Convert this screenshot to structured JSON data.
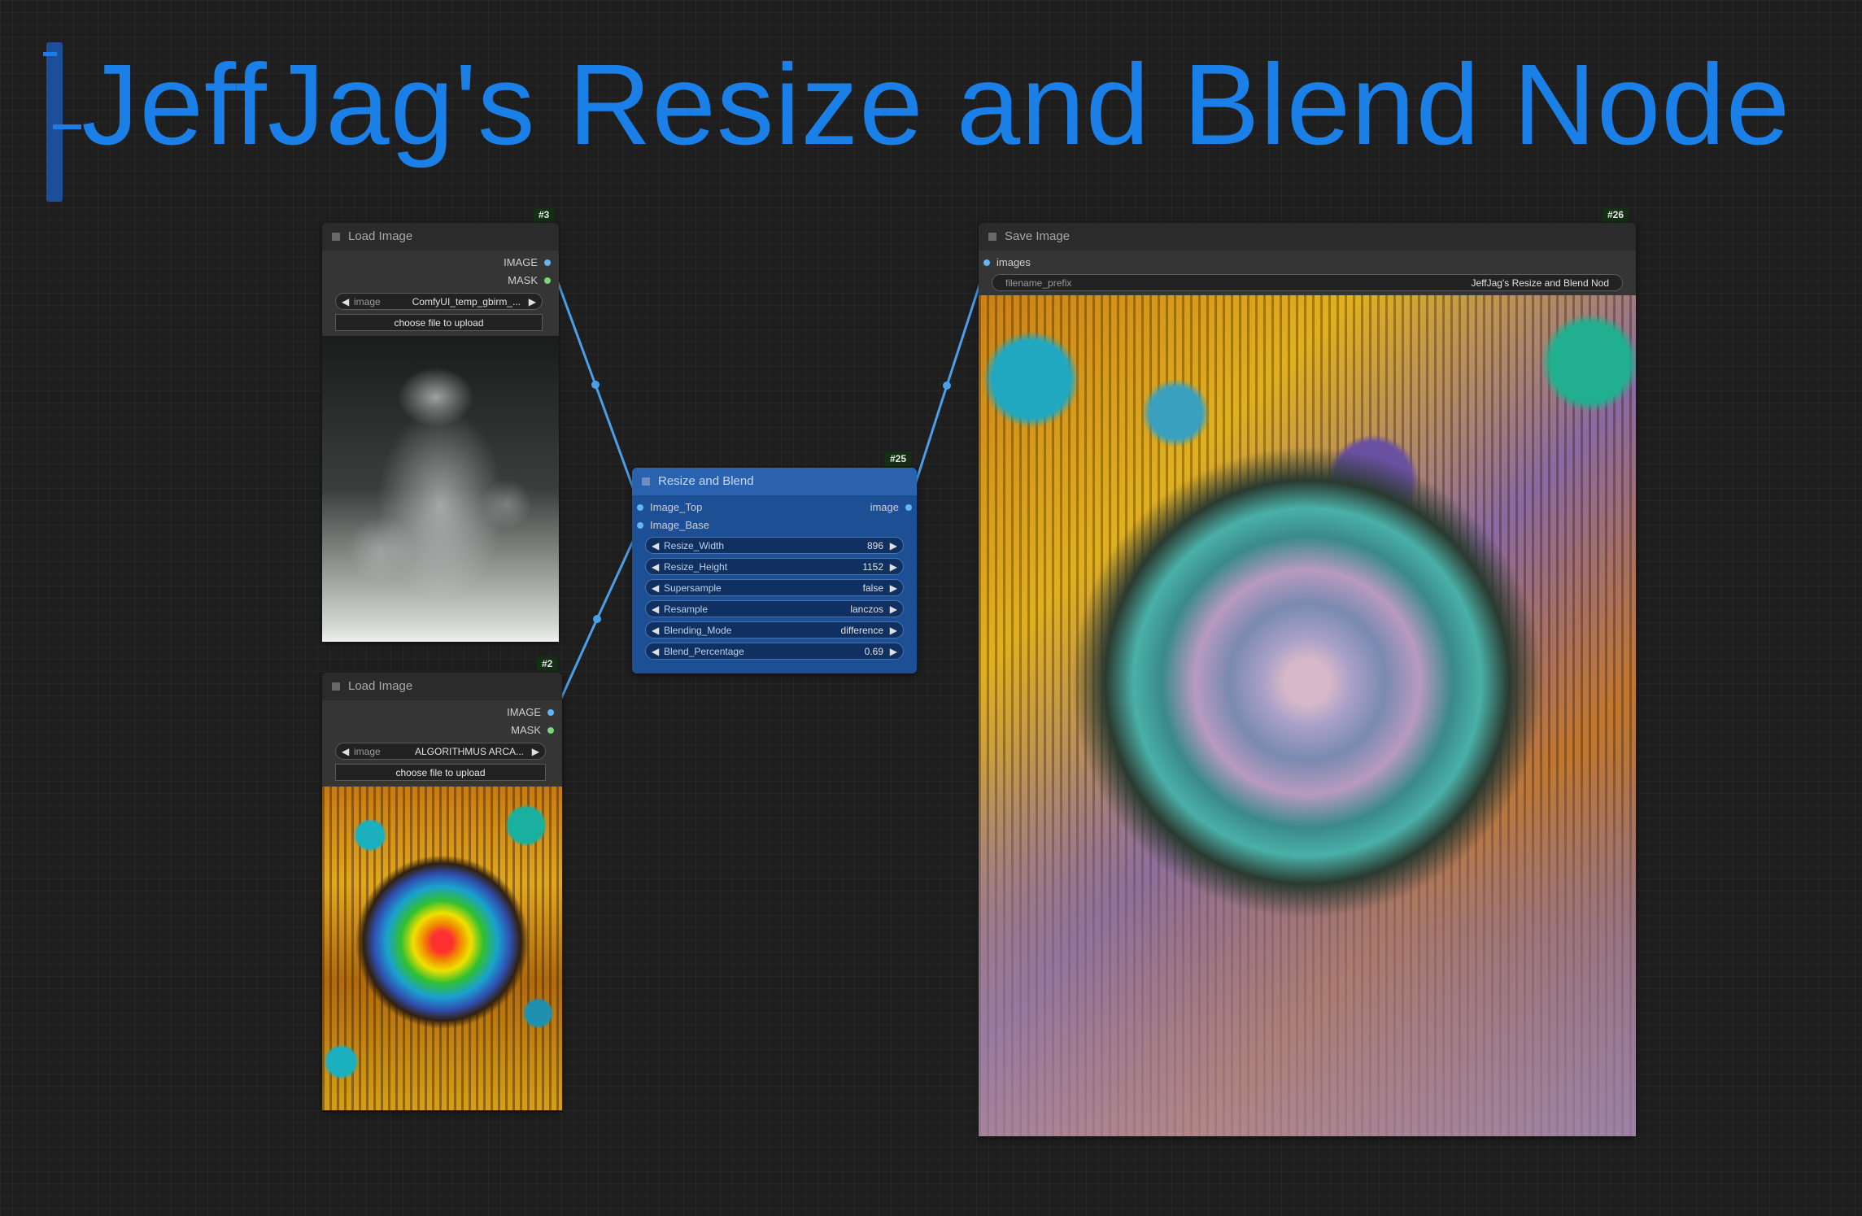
{
  "group": {
    "title": "JeffJag's Resize and Blend Node"
  },
  "nodes": {
    "load1": {
      "id": "#3",
      "title": "Load Image",
      "outputs": [
        "IMAGE",
        "MASK"
      ],
      "widget_label": "image",
      "widget_value": "ComfyUI_temp_gbirm_...",
      "button": "choose file to upload"
    },
    "load2": {
      "id": "#2",
      "title": "Load Image",
      "outputs": [
        "IMAGE",
        "MASK"
      ],
      "widget_label": "image",
      "widget_value": "ALGORITHMUS ARCA...",
      "button": "choose file to upload"
    },
    "resize": {
      "id": "#25",
      "title": "Resize and Blend",
      "inputs": [
        "Image_Top",
        "Image_Base"
      ],
      "output": "image",
      "widgets": [
        {
          "label": "Resize_Width",
          "value": "896"
        },
        {
          "label": "Resize_Height",
          "value": "1152"
        },
        {
          "label": "Supersample",
          "value": "false"
        },
        {
          "label": "Resample",
          "value": "lanczos"
        },
        {
          "label": "Blending_Mode",
          "value": "difference"
        },
        {
          "label": "Blend_Percentage",
          "value": "0.69"
        }
      ]
    },
    "save": {
      "id": "#26",
      "title": "Save Image",
      "input": "images",
      "widget_label": "filename_prefix",
      "widget_value": "JeffJag's Resize and Blend Nod"
    }
  },
  "colors": {
    "canvas": "#1e1e1e",
    "group_title": "#1a80e8",
    "node_bg": "#353535",
    "node_blue": "#1c4f94",
    "wire": "#4a9fe8",
    "pin_image": "#64b5f6",
    "pin_mask": "#7bd67b"
  }
}
